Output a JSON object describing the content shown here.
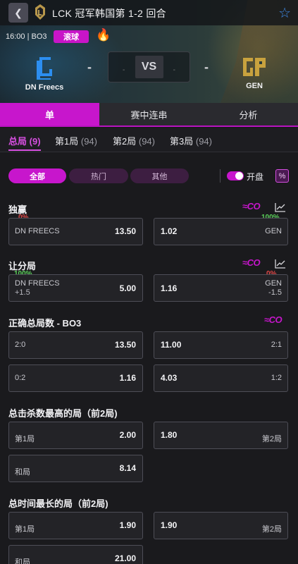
{
  "header": {
    "title": "LCK 冠军韩国第 1-2 回合",
    "match_time": "16:00 | BO3",
    "live_label": "滚球",
    "vs_label": "VS"
  },
  "teams": {
    "left": {
      "name": "DN Freecs"
    },
    "right": {
      "name": "GEN"
    }
  },
  "main_tabs": [
    "单",
    "赛中连串",
    "分析"
  ],
  "sub_tabs": [
    {
      "label": "总局",
      "count": "(9)"
    },
    {
      "label": "第1局",
      "count": "(94)"
    },
    {
      "label": "第2局",
      "count": "(94)"
    },
    {
      "label": "第3局",
      "count": "(94)"
    }
  ],
  "filters": {
    "all": "全部",
    "hot": "热门",
    "other": "其他",
    "open_label": "开盘",
    "pct_icon": "%"
  },
  "markets": {
    "winner": {
      "title": "独赢",
      "left": {
        "label": "DN FREECS",
        "odds": "13.50",
        "pct": "0%"
      },
      "right": {
        "label": "GEN",
        "odds": "1.02",
        "pct": "100%"
      }
    },
    "handicap": {
      "title": "让分局",
      "left": {
        "label": "DN FREECS",
        "line": "+1.5",
        "odds": "5.00",
        "pct": "100%"
      },
      "right": {
        "label": "GEN",
        "line": "-1.5",
        "odds": "1.16",
        "pct": "0%"
      }
    },
    "correct_score": {
      "title": "正确总局数 - BO3",
      "rows": [
        {
          "left_label": "2:0",
          "left_odds": "13.50",
          "right_odds": "11.00",
          "right_label": "2:1"
        },
        {
          "left_label": "0:2",
          "left_odds": "1.16",
          "right_odds": "4.03",
          "right_label": "1:2"
        }
      ]
    },
    "most_kills": {
      "title": "总击杀数最高的局（前2局)",
      "left": {
        "label": "第1局",
        "odds": "2.00"
      },
      "right": {
        "label": "第2局",
        "odds": "1.80"
      },
      "draw": {
        "label": "和局",
        "odds": "8.14"
      }
    },
    "longest": {
      "title": "总时间最长的局（前2局)",
      "left": {
        "label": "第1局",
        "odds": "1.90"
      },
      "right": {
        "label": "第2局",
        "odds": "1.90"
      },
      "draw": {
        "label": "和局",
        "odds": "21.00"
      }
    },
    "co_label": "CO"
  },
  "colors": {
    "accent": "#c716cc",
    "pct_red": "#e04848",
    "pct_green": "#5ad05a",
    "star": "#3f8be8"
  }
}
